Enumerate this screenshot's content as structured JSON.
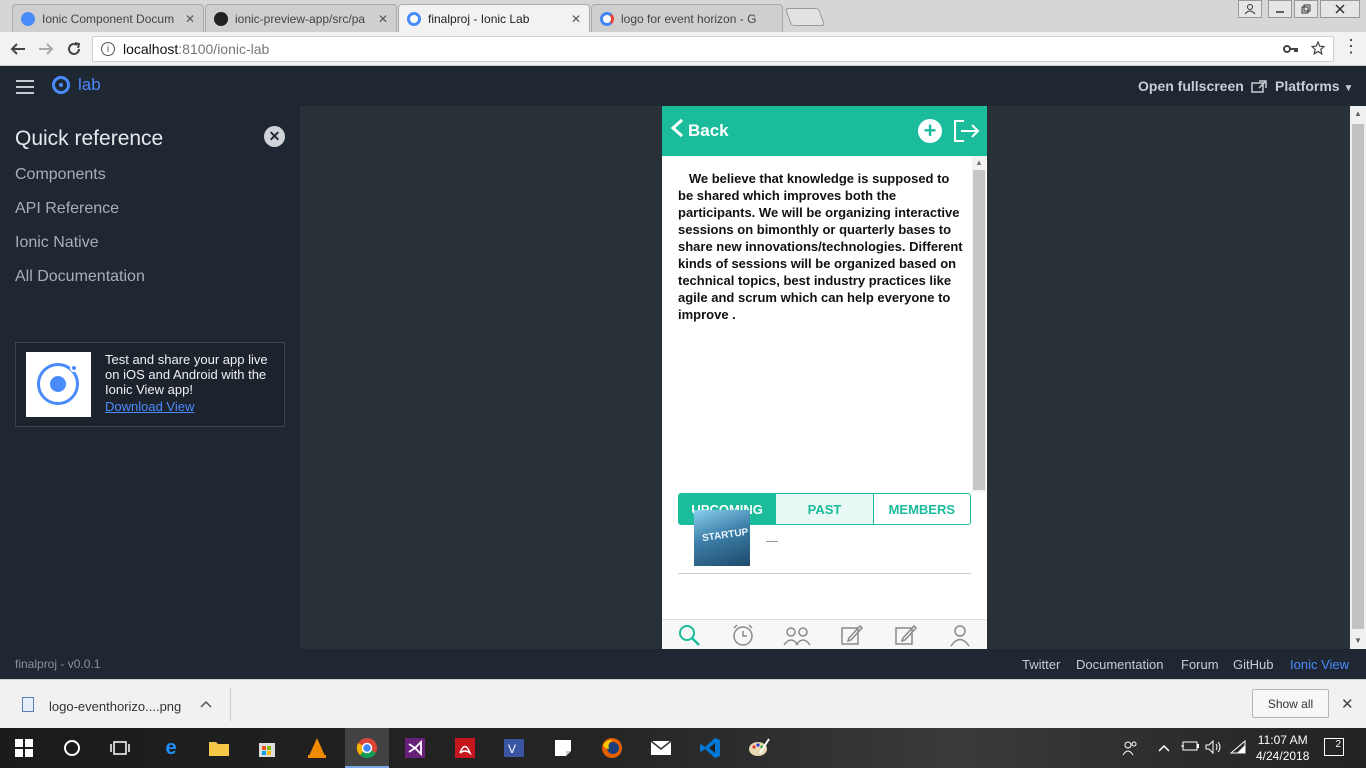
{
  "browser": {
    "tabs": [
      {
        "label": "Ionic Component Docum",
        "icon": "chrome-icon",
        "color": "#4a8bfc"
      },
      {
        "label": "ionic-preview-app/src/pa",
        "icon": "github-icon",
        "color": "#222222"
      },
      {
        "label": "finalproj - Ionic Lab",
        "icon": "ionic-icon",
        "color": "#4a8bfc"
      },
      {
        "label": "logo for event horizon - G",
        "icon": "google-icon",
        "color": "#4285f4"
      }
    ],
    "close_glyph": "✕",
    "url_host": "localhost",
    "url_path": ":8100/ionic-lab"
  },
  "lab": {
    "brand": "lab",
    "open_fullscreen": "Open fullscreen",
    "platforms": "Platforms"
  },
  "sidebar": {
    "title": "Quick reference",
    "links": [
      "Components",
      "API Reference",
      "Ionic Native",
      "All Documentation"
    ],
    "promo_text": "Test and share your app live on iOS and Android with the Ionic View app!",
    "promo_link": "Download View"
  },
  "phone": {
    "back_label": "Back",
    "about": "We believe that knowledge is supposed to be shared which improves both the participants. We will be organizing interactive sessions on bimonthly or quarterly bases to share new innovations/technologies. Different kinds of sessions will be organized based on technical topics, best industry practices like agile and scrum which can help everyone to improve .",
    "segments": [
      "UPCOMING",
      "PAST",
      "MEMBERS"
    ],
    "active_segment": "UPCOMING",
    "event_thumb_text": "STARTUP",
    "accent_color": "#1abc9c"
  },
  "footer": {
    "version": "finalproj - v0.0.1",
    "links": [
      "Twitter",
      "Documentation",
      "Forum",
      "GitHub",
      "Ionic View"
    ]
  },
  "downloads": {
    "file_name": "logo-eventhorizo....png",
    "show_all": "Show all"
  },
  "taskbar": {
    "time": "11:07 AM",
    "date": "4/24/2018",
    "notification_count": "2"
  }
}
